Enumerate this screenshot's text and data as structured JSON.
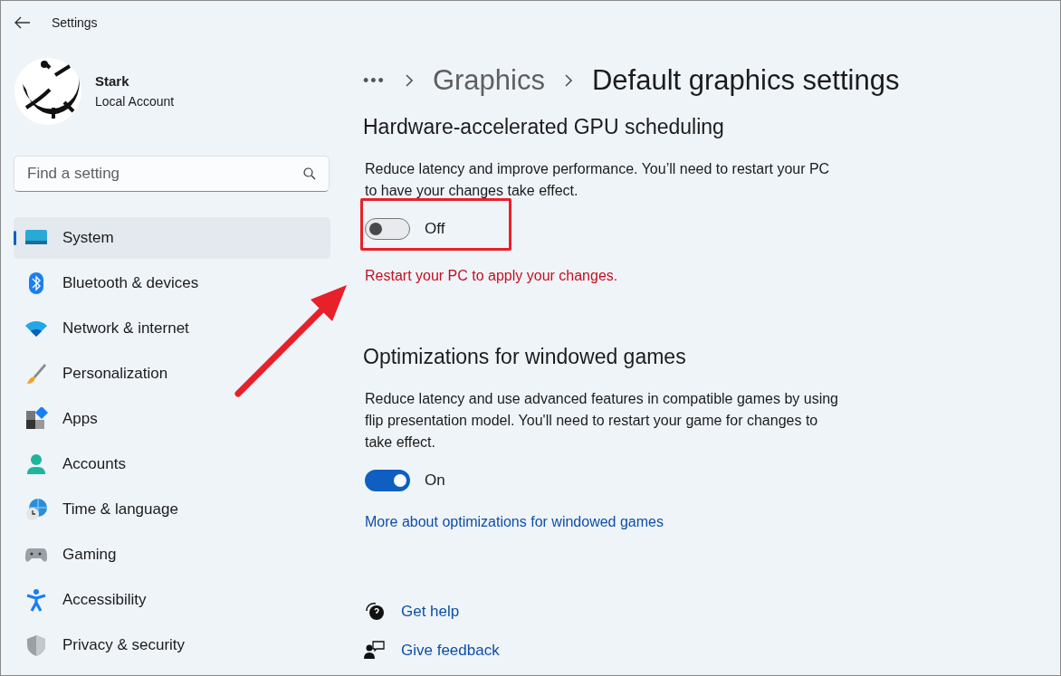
{
  "window": {
    "title": "Settings"
  },
  "account": {
    "name": "Stark",
    "type": "Local Account"
  },
  "search": {
    "placeholder": "Find a setting"
  },
  "sidebar": {
    "items": [
      {
        "label": "System",
        "selected": true
      },
      {
        "label": "Bluetooth & devices",
        "selected": false
      },
      {
        "label": "Network & internet",
        "selected": false
      },
      {
        "label": "Personalization",
        "selected": false
      },
      {
        "label": "Apps",
        "selected": false
      },
      {
        "label": "Accounts",
        "selected": false
      },
      {
        "label": "Time & language",
        "selected": false
      },
      {
        "label": "Gaming",
        "selected": false
      },
      {
        "label": "Accessibility",
        "selected": false
      },
      {
        "label": "Privacy & security",
        "selected": false
      }
    ]
  },
  "breadcrumb": [
    "•••",
    "Graphics",
    "Default graphics settings"
  ],
  "sections": [
    {
      "title": "Hardware-accelerated GPU scheduling",
      "description": "Reduce latency and improve performance. You’ll need to restart your PC to have your changes take effect.",
      "toggle": {
        "on": false,
        "label": "Off"
      },
      "warning": "Restart your PC to apply your changes.",
      "highlighted": true
    },
    {
      "title": "Optimizations for windowed games",
      "description": "Reduce latency and use advanced features in compatible games by using flip presentation model. You'll need to restart your game for changes to take effect.",
      "toggle": {
        "on": true,
        "label": "On"
      },
      "link": "More about optimizations for windowed games",
      "highlighted": false
    }
  ],
  "help_links": [
    "Get help",
    "Give feedback"
  ]
}
